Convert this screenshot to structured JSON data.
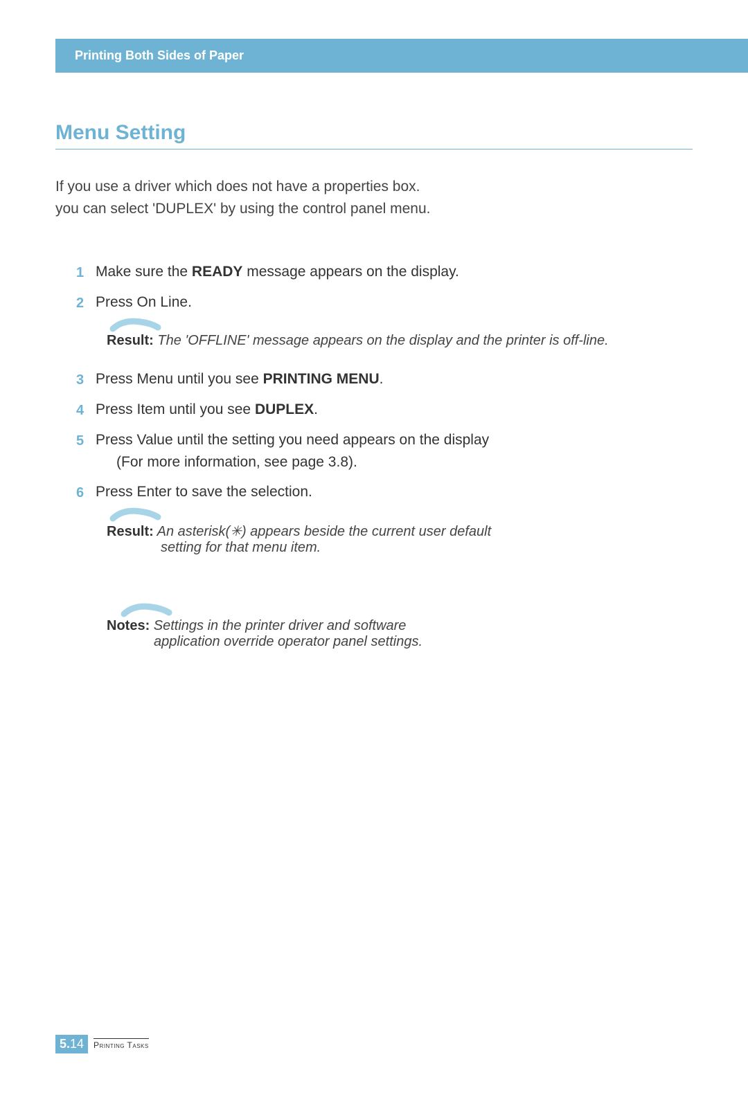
{
  "header": {
    "title": "Printing Both Sides of Paper"
  },
  "section": {
    "title": "Menu Setting"
  },
  "intro": {
    "line1": "If you use a driver which does not have a properties box.",
    "line2": "you can select 'DUPLEX' by using the control panel menu."
  },
  "steps": [
    {
      "num": "1",
      "text_before": "Make sure the ",
      "bold": "READY",
      "text_after": " message appears on the display."
    },
    {
      "num": "2",
      "text_before": "Press On Line.",
      "bold": "",
      "text_after": ""
    },
    {
      "num": "3",
      "text_before": "Press Menu until you see ",
      "bold": "PRINTING MENU",
      "text_after": "."
    },
    {
      "num": "4",
      "text_before": "Press Item until you see ",
      "bold": "DUPLEX",
      "text_after": "."
    },
    {
      "num": "5",
      "text_before": "Press Value until the setting you need appears on the display",
      "bold": "",
      "text_after": "",
      "sub": "(For more information, see page 3.8)."
    },
    {
      "num": "6",
      "text_before": "Press Enter to save the selection.",
      "bold": "",
      "text_after": ""
    }
  ],
  "result1": {
    "label": "Result:",
    "text": " The 'OFFLINE' message appears on the display and the printer is off-line."
  },
  "result2": {
    "label": "Result:",
    "text": " An asterisk(✳) appears beside the current user default",
    "line2": "setting for that menu item."
  },
  "notes": {
    "label": "Notes:",
    "text": " Settings in the printer driver and software",
    "line2": "application override operator panel settings."
  },
  "footer": {
    "page_major": "5.",
    "page_minor": "14",
    "chapter": "Printing Tasks"
  }
}
